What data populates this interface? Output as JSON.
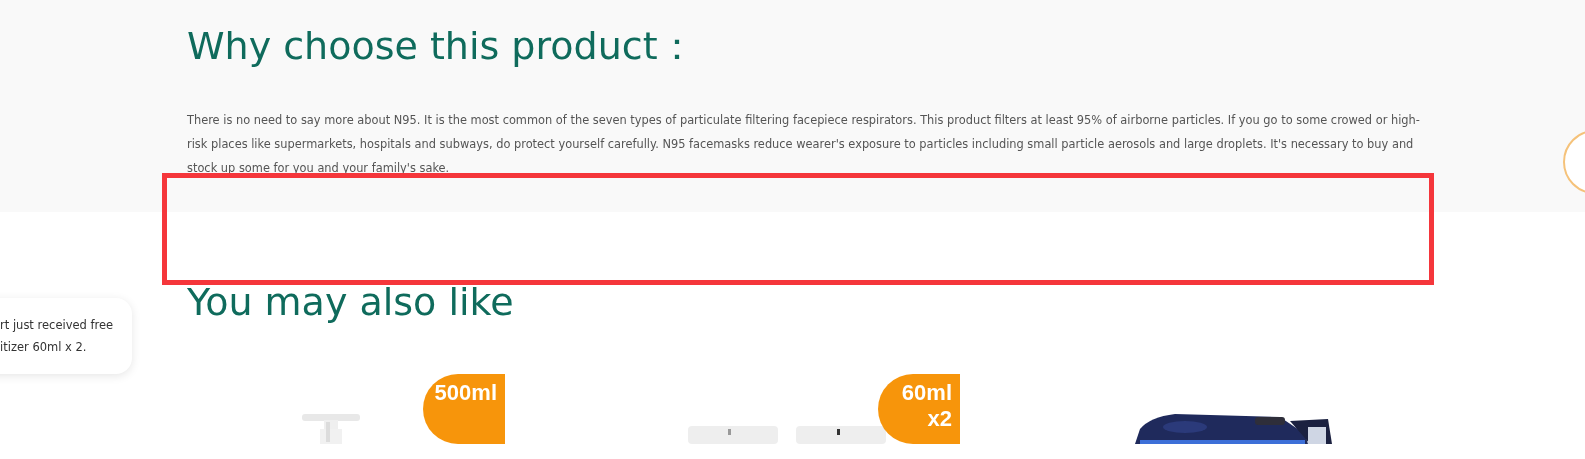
{
  "why_section": {
    "heading": "Why choose this product：",
    "paragraph": "There is no need to say more about N95. It is the most common of the seven types of particulate filtering facepiece respirators. This product filters at least 95% of airborne particles. If you go to some crowed or high-risk places like supermarkets, hospitals and subways, do protect yourself carefully. N95 facemasks reduce wearer's exposure to particles including small particle aerosols and large droplets. It's necessary to buy and stock up some for you and your family's sake."
  },
  "related_section": {
    "heading": "You may also like",
    "products": [
      {
        "kind": "bottle",
        "badge": [
          "500ml"
        ]
      },
      {
        "kind": "sanitizer",
        "badge": [
          "60ml",
          "x2"
        ]
      },
      {
        "kind": "pitcher"
      }
    ]
  },
  "toast": {
    "lines": [
      "rt just received free",
      "itizer 60ml x 2."
    ]
  }
}
